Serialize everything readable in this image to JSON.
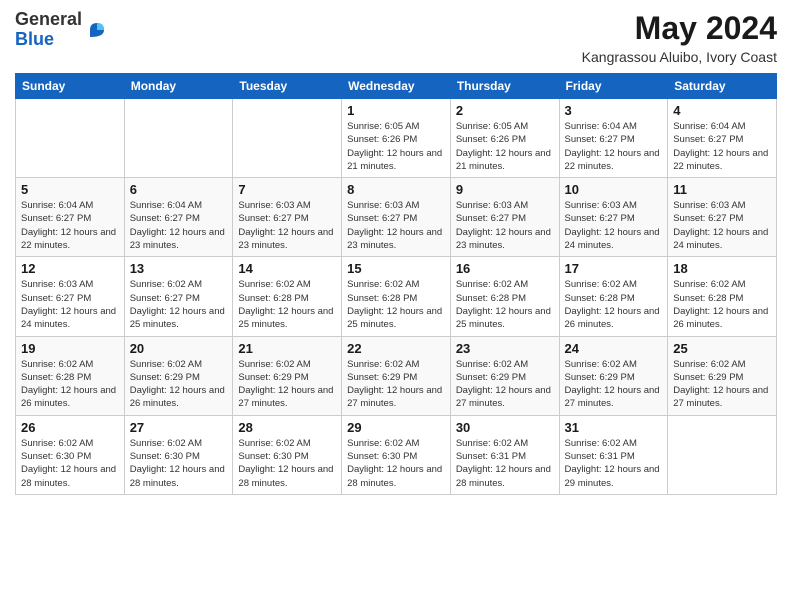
{
  "logo": {
    "general": "General",
    "blue": "Blue"
  },
  "title": "May 2024",
  "location": "Kangrassou Aluibo, Ivory Coast",
  "days_of_week": [
    "Sunday",
    "Monday",
    "Tuesday",
    "Wednesday",
    "Thursday",
    "Friday",
    "Saturday"
  ],
  "weeks": [
    [
      {
        "day": "",
        "sunrise": "",
        "sunset": "",
        "daylight": ""
      },
      {
        "day": "",
        "sunrise": "",
        "sunset": "",
        "daylight": ""
      },
      {
        "day": "",
        "sunrise": "",
        "sunset": "",
        "daylight": ""
      },
      {
        "day": "1",
        "sunrise": "Sunrise: 6:05 AM",
        "sunset": "Sunset: 6:26 PM",
        "daylight": "Daylight: 12 hours and 21 minutes."
      },
      {
        "day": "2",
        "sunrise": "Sunrise: 6:05 AM",
        "sunset": "Sunset: 6:26 PM",
        "daylight": "Daylight: 12 hours and 21 minutes."
      },
      {
        "day": "3",
        "sunrise": "Sunrise: 6:04 AM",
        "sunset": "Sunset: 6:27 PM",
        "daylight": "Daylight: 12 hours and 22 minutes."
      },
      {
        "day": "4",
        "sunrise": "Sunrise: 6:04 AM",
        "sunset": "Sunset: 6:27 PM",
        "daylight": "Daylight: 12 hours and 22 minutes."
      }
    ],
    [
      {
        "day": "5",
        "sunrise": "Sunrise: 6:04 AM",
        "sunset": "Sunset: 6:27 PM",
        "daylight": "Daylight: 12 hours and 22 minutes."
      },
      {
        "day": "6",
        "sunrise": "Sunrise: 6:04 AM",
        "sunset": "Sunset: 6:27 PM",
        "daylight": "Daylight: 12 hours and 23 minutes."
      },
      {
        "day": "7",
        "sunrise": "Sunrise: 6:03 AM",
        "sunset": "Sunset: 6:27 PM",
        "daylight": "Daylight: 12 hours and 23 minutes."
      },
      {
        "day": "8",
        "sunrise": "Sunrise: 6:03 AM",
        "sunset": "Sunset: 6:27 PM",
        "daylight": "Daylight: 12 hours and 23 minutes."
      },
      {
        "day": "9",
        "sunrise": "Sunrise: 6:03 AM",
        "sunset": "Sunset: 6:27 PM",
        "daylight": "Daylight: 12 hours and 23 minutes."
      },
      {
        "day": "10",
        "sunrise": "Sunrise: 6:03 AM",
        "sunset": "Sunset: 6:27 PM",
        "daylight": "Daylight: 12 hours and 24 minutes."
      },
      {
        "day": "11",
        "sunrise": "Sunrise: 6:03 AM",
        "sunset": "Sunset: 6:27 PM",
        "daylight": "Daylight: 12 hours and 24 minutes."
      }
    ],
    [
      {
        "day": "12",
        "sunrise": "Sunrise: 6:03 AM",
        "sunset": "Sunset: 6:27 PM",
        "daylight": "Daylight: 12 hours and 24 minutes."
      },
      {
        "day": "13",
        "sunrise": "Sunrise: 6:02 AM",
        "sunset": "Sunset: 6:27 PM",
        "daylight": "Daylight: 12 hours and 25 minutes."
      },
      {
        "day": "14",
        "sunrise": "Sunrise: 6:02 AM",
        "sunset": "Sunset: 6:28 PM",
        "daylight": "Daylight: 12 hours and 25 minutes."
      },
      {
        "day": "15",
        "sunrise": "Sunrise: 6:02 AM",
        "sunset": "Sunset: 6:28 PM",
        "daylight": "Daylight: 12 hours and 25 minutes."
      },
      {
        "day": "16",
        "sunrise": "Sunrise: 6:02 AM",
        "sunset": "Sunset: 6:28 PM",
        "daylight": "Daylight: 12 hours and 25 minutes."
      },
      {
        "day": "17",
        "sunrise": "Sunrise: 6:02 AM",
        "sunset": "Sunset: 6:28 PM",
        "daylight": "Daylight: 12 hours and 26 minutes."
      },
      {
        "day": "18",
        "sunrise": "Sunrise: 6:02 AM",
        "sunset": "Sunset: 6:28 PM",
        "daylight": "Daylight: 12 hours and 26 minutes."
      }
    ],
    [
      {
        "day": "19",
        "sunrise": "Sunrise: 6:02 AM",
        "sunset": "Sunset: 6:28 PM",
        "daylight": "Daylight: 12 hours and 26 minutes."
      },
      {
        "day": "20",
        "sunrise": "Sunrise: 6:02 AM",
        "sunset": "Sunset: 6:29 PM",
        "daylight": "Daylight: 12 hours and 26 minutes."
      },
      {
        "day": "21",
        "sunrise": "Sunrise: 6:02 AM",
        "sunset": "Sunset: 6:29 PM",
        "daylight": "Daylight: 12 hours and 27 minutes."
      },
      {
        "day": "22",
        "sunrise": "Sunrise: 6:02 AM",
        "sunset": "Sunset: 6:29 PM",
        "daylight": "Daylight: 12 hours and 27 minutes."
      },
      {
        "day": "23",
        "sunrise": "Sunrise: 6:02 AM",
        "sunset": "Sunset: 6:29 PM",
        "daylight": "Daylight: 12 hours and 27 minutes."
      },
      {
        "day": "24",
        "sunrise": "Sunrise: 6:02 AM",
        "sunset": "Sunset: 6:29 PM",
        "daylight": "Daylight: 12 hours and 27 minutes."
      },
      {
        "day": "25",
        "sunrise": "Sunrise: 6:02 AM",
        "sunset": "Sunset: 6:29 PM",
        "daylight": "Daylight: 12 hours and 27 minutes."
      }
    ],
    [
      {
        "day": "26",
        "sunrise": "Sunrise: 6:02 AM",
        "sunset": "Sunset: 6:30 PM",
        "daylight": "Daylight: 12 hours and 28 minutes."
      },
      {
        "day": "27",
        "sunrise": "Sunrise: 6:02 AM",
        "sunset": "Sunset: 6:30 PM",
        "daylight": "Daylight: 12 hours and 28 minutes."
      },
      {
        "day": "28",
        "sunrise": "Sunrise: 6:02 AM",
        "sunset": "Sunset: 6:30 PM",
        "daylight": "Daylight: 12 hours and 28 minutes."
      },
      {
        "day": "29",
        "sunrise": "Sunrise: 6:02 AM",
        "sunset": "Sunset: 6:30 PM",
        "daylight": "Daylight: 12 hours and 28 minutes."
      },
      {
        "day": "30",
        "sunrise": "Sunrise: 6:02 AM",
        "sunset": "Sunset: 6:31 PM",
        "daylight": "Daylight: 12 hours and 28 minutes."
      },
      {
        "day": "31",
        "sunrise": "Sunrise: 6:02 AM",
        "sunset": "Sunset: 6:31 PM",
        "daylight": "Daylight: 12 hours and 29 minutes."
      },
      {
        "day": "",
        "sunrise": "",
        "sunset": "",
        "daylight": ""
      }
    ]
  ]
}
